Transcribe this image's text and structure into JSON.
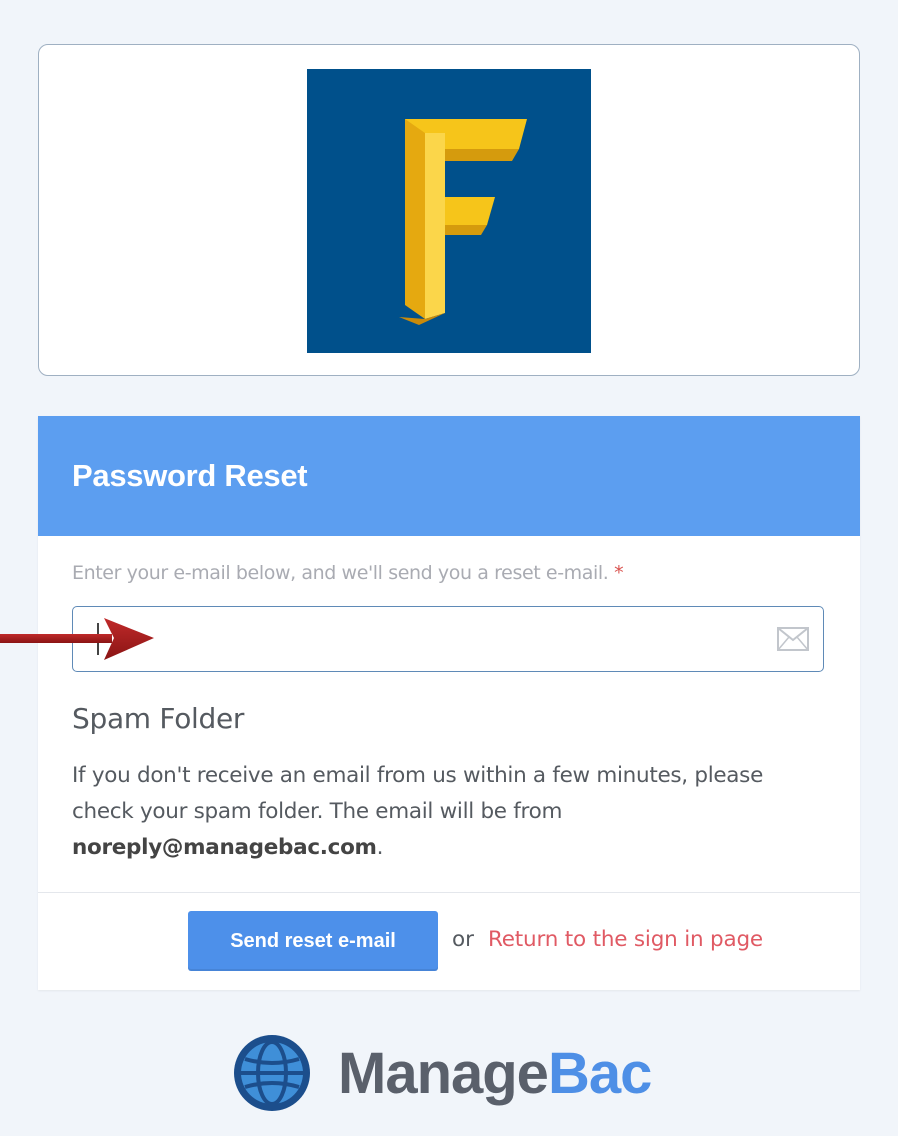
{
  "logo": {
    "letter": "F",
    "background": "#00508b",
    "letter_color": "#f6c51a"
  },
  "reset": {
    "title": "Password Reset",
    "instruction": "Enter your e-mail below, and we'll send you a reset e-mail.",
    "required_mark": "*",
    "email_value": "",
    "email_icon": "envelope-icon",
    "spam_title": "Spam Folder",
    "spam_text_before": "If you don't receive an email from us within a few minutes, please check your spam folder. The email will be from ",
    "spam_email": "noreply@managebac.com",
    "spam_text_after": ".",
    "send_label": "Send reset e-mail",
    "or_text": "or",
    "return_label": "Return to the sign in page"
  },
  "annotation": {
    "arrow_color": "#a31c1c"
  },
  "brand": {
    "name_part1": "Manage",
    "name_part2": "Bac",
    "icon": "globe-icon",
    "accent": "#4e8fe6"
  }
}
